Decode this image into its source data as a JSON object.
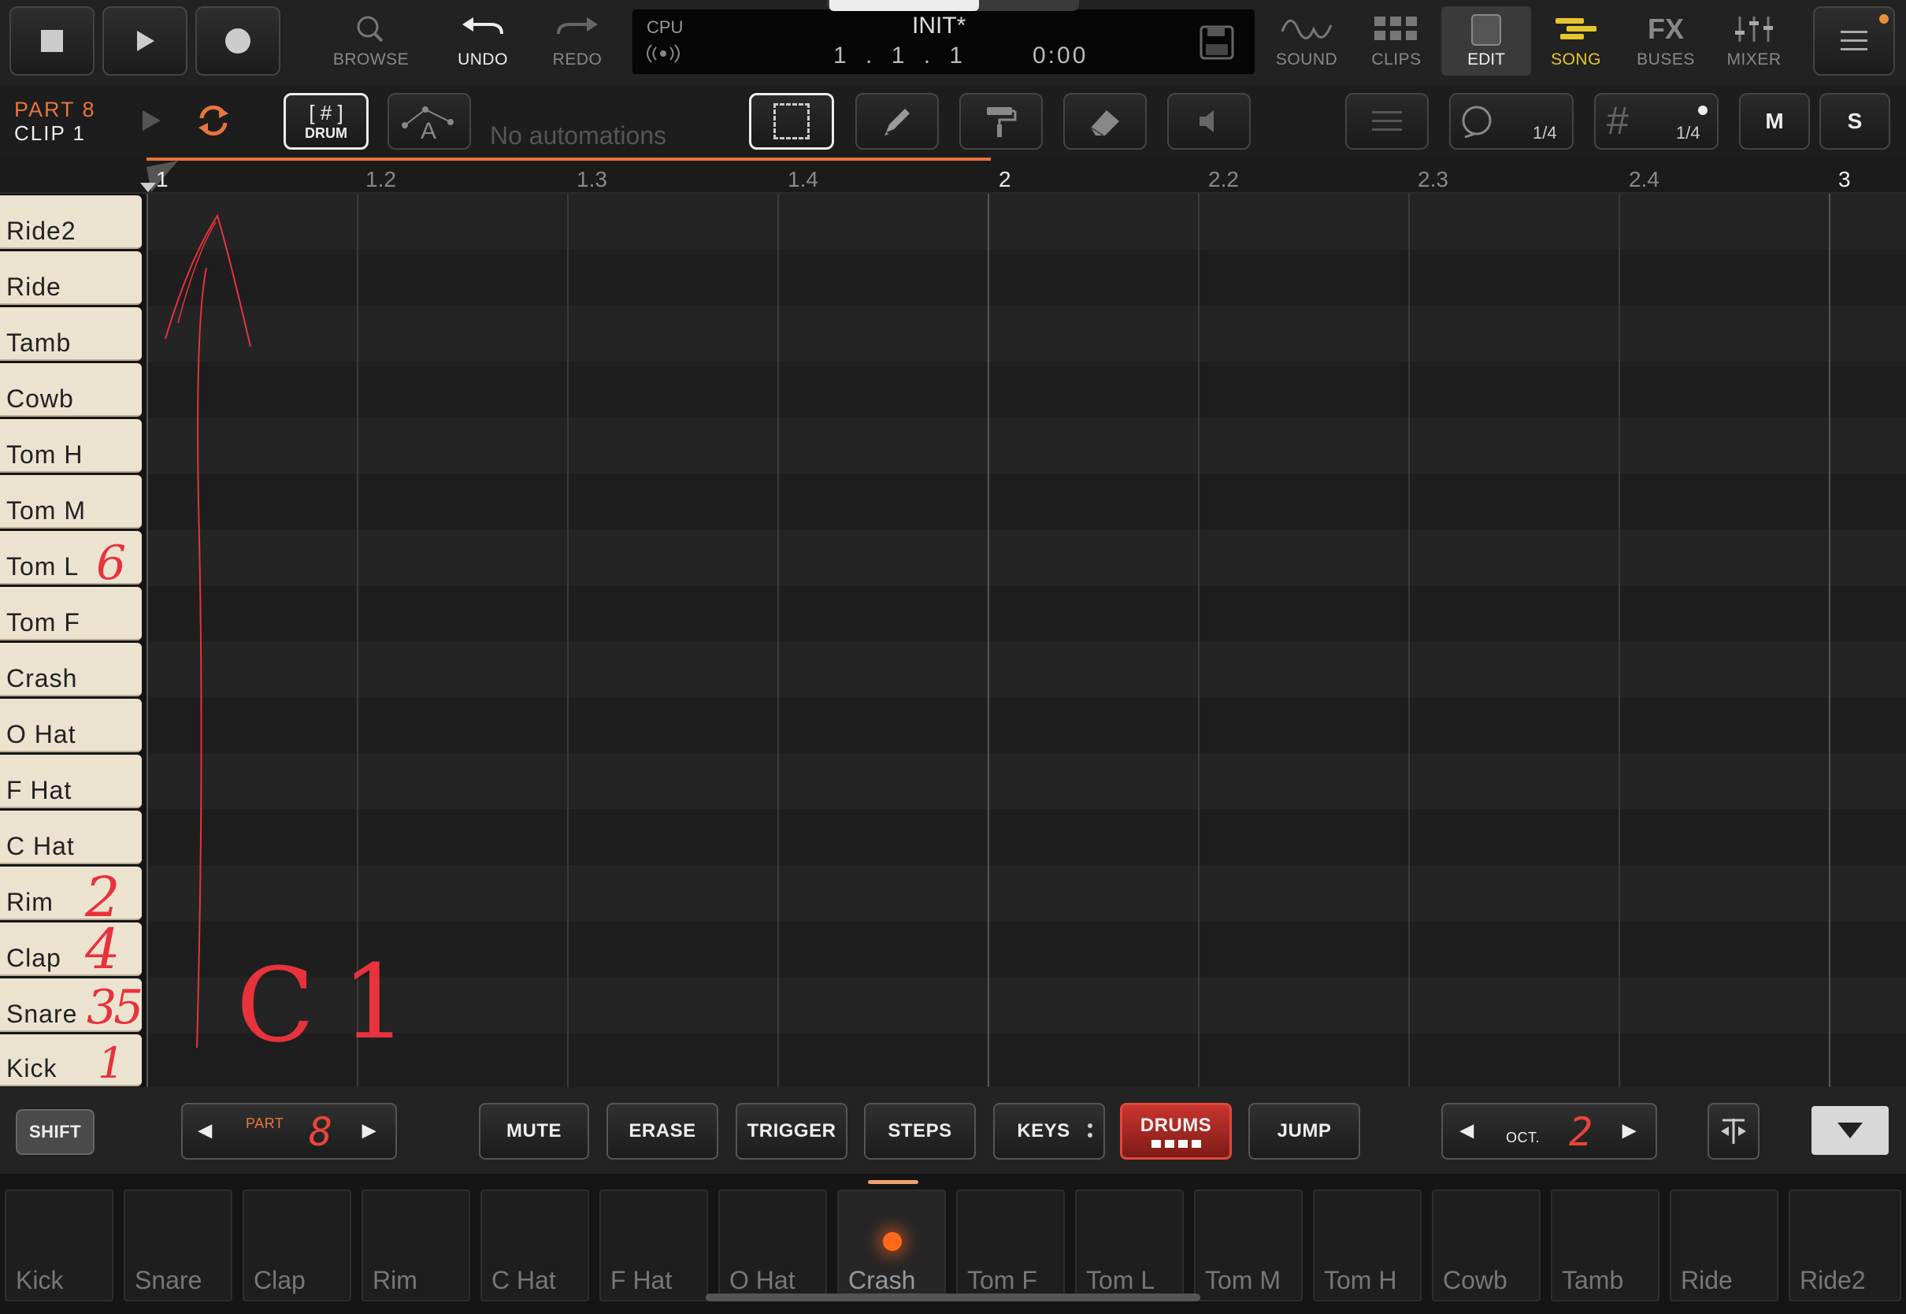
{
  "transport": {
    "stop_label": "",
    "browse_label": "BROWSE",
    "undo_label": "UNDO",
    "redo_label": "REDO",
    "cpu_label": "CPU",
    "project_name": "INIT*",
    "position": "1 . 1 . 1",
    "time": "0:00",
    "nav": {
      "sound": "SOUND",
      "clips": "CLIPS",
      "edit": "EDIT",
      "song": "SONG",
      "fx_top": "FX",
      "buses": "BUSES",
      "mixer": "MIXER"
    }
  },
  "toolbar": {
    "part_label": "PART 8",
    "clip_label": "CLIP 1",
    "drum_mode_top": "[ # ]",
    "drum_mode_bottom": "DRUM",
    "automation_letter": "A",
    "automation_text": "No automations",
    "loop_value": "1/4",
    "grid_value": "1/4",
    "mute_label": "M",
    "solo_label": "S"
  },
  "ruler": {
    "labels": [
      "1",
      "1.2",
      "1.3",
      "1.4",
      "2",
      "2.2",
      "2.3",
      "2.4",
      "3"
    ]
  },
  "drum_keys": [
    "Ride2",
    "Ride",
    "Tamb",
    "Cowb",
    "Tom H",
    "Tom M",
    "Tom L",
    "Tom F",
    "Crash",
    "O Hat",
    "F Hat",
    "C Hat",
    "Rim",
    "Clap",
    "Snare",
    "Kick"
  ],
  "annotations": {
    "tom_l": "6",
    "rim": "2",
    "clap": "4",
    "snare": "35",
    "kick": "1",
    "note_c": "C",
    "note_1": "1"
  },
  "bottom": {
    "shift": "SHIFT",
    "part_label": "PART",
    "part_value": "8",
    "mute": "MUTE",
    "erase": "ERASE",
    "trigger": "TRIGGER",
    "steps": "STEPS",
    "keys": "KEYS",
    "drums": "DRUMS",
    "jump": "JUMP",
    "oct_label": "OCT.",
    "oct_value": "2"
  },
  "pads": [
    "Kick",
    "Snare",
    "Clap",
    "Rim",
    "C Hat",
    "F Hat",
    "O Hat",
    "Crash",
    "Tom F",
    "Tom L",
    "Tom M",
    "Tom H",
    "Cowb",
    "Tamb",
    "Ride",
    "Ride2"
  ],
  "colors": {
    "accent": "#e8753a",
    "song": "#e6c62f",
    "annotation": "#e8323c",
    "drums_active": "#d8302f"
  }
}
